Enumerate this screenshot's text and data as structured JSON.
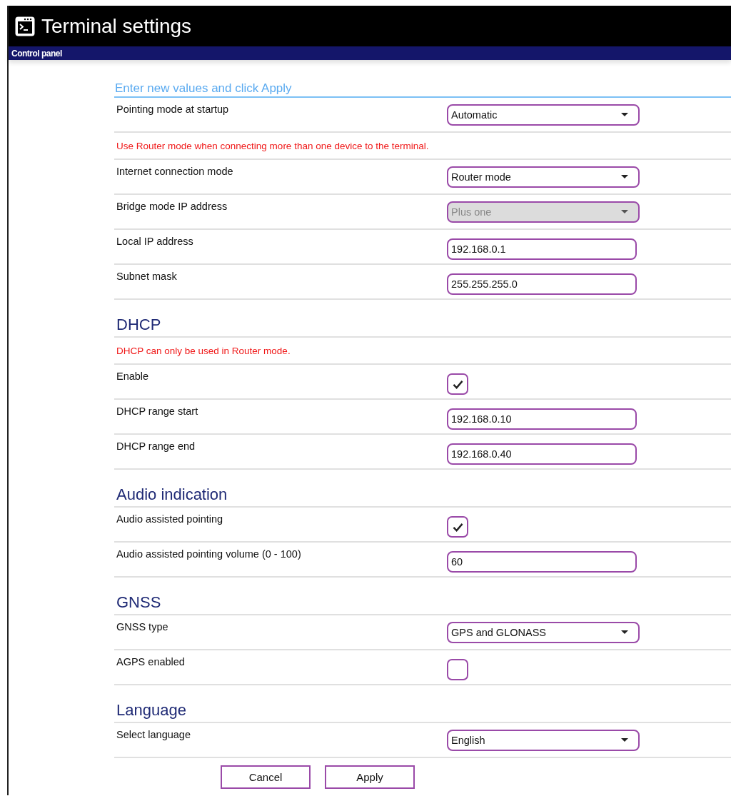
{
  "window": {
    "title": "Terminal settings"
  },
  "nav_bar": {
    "label": "Control panel"
  },
  "form": {
    "intro": "Enter new values and click Apply",
    "sections": [
      {
        "rows": [
          {
            "kind": "select",
            "label": "Pointing mode at startup",
            "value": "Automatic",
            "disabled": false
          },
          {
            "kind": "note",
            "text": "Use Router mode when connecting more than one device to the terminal."
          },
          {
            "kind": "select",
            "label": "Internet connection mode",
            "value": "Router mode",
            "disabled": false
          },
          {
            "kind": "select",
            "label": "Bridge mode IP address",
            "value": "Plus one",
            "disabled": true
          },
          {
            "kind": "text",
            "label": "Local IP address",
            "value": "192.168.0.1"
          },
          {
            "kind": "text",
            "label": "Subnet mask",
            "value": "255.255.255.0"
          }
        ]
      },
      {
        "heading": "DHCP",
        "rows": [
          {
            "kind": "note",
            "text": "DHCP can only be used in Router mode."
          },
          {
            "kind": "checkbox",
            "label": "Enable",
            "checked": true
          },
          {
            "kind": "text",
            "label": "DHCP range start",
            "value": "192.168.0.10"
          },
          {
            "kind": "text",
            "label": "DHCP range end",
            "value": "192.168.0.40"
          }
        ]
      },
      {
        "heading": "Audio indication",
        "rows": [
          {
            "kind": "checkbox",
            "label": "Audio assisted pointing",
            "checked": true
          },
          {
            "kind": "text",
            "label": "Audio assisted pointing volume (0 - 100)",
            "value": "60"
          }
        ]
      },
      {
        "heading": "GNSS",
        "rows": [
          {
            "kind": "select",
            "label": "GNSS type",
            "value": "GPS and GLONASS",
            "disabled": false
          },
          {
            "kind": "checkbox",
            "label": "AGPS enabled",
            "checked": false
          }
        ]
      },
      {
        "heading": "Language",
        "rows": [
          {
            "kind": "select",
            "label": "Select language",
            "value": "English",
            "disabled": false
          }
        ]
      }
    ],
    "buttons": [
      "Cancel",
      "Apply"
    ]
  }
}
